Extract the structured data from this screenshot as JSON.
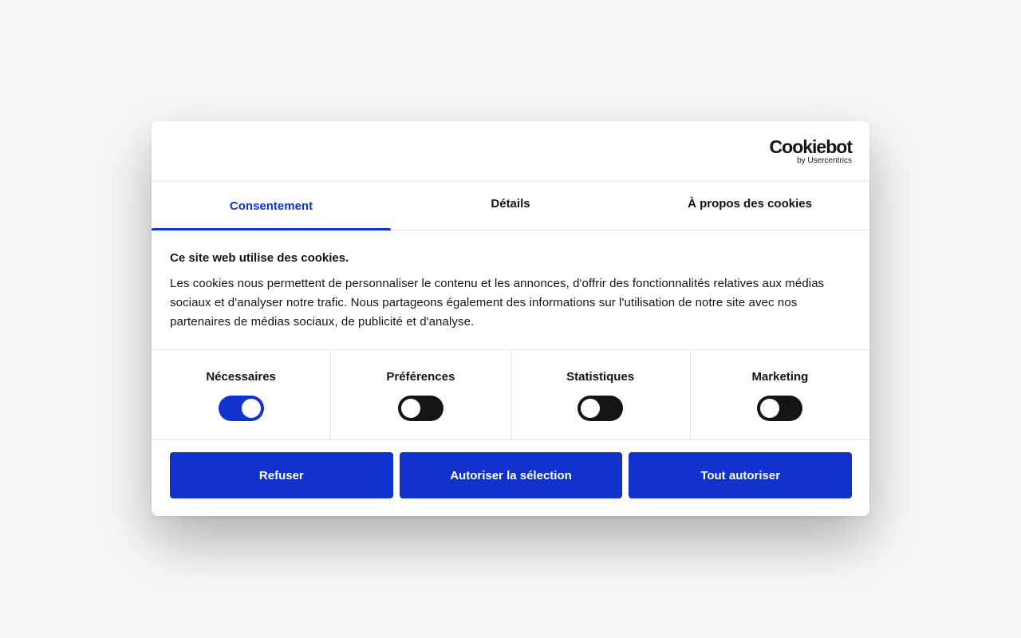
{
  "logo": {
    "main": "Cookiebot",
    "sub": "by Usercentrics"
  },
  "tabs": [
    {
      "label": "Consentement",
      "active": true
    },
    {
      "label": "Détails",
      "active": false
    },
    {
      "label": "À propos des cookies",
      "active": false
    }
  ],
  "content": {
    "title": "Ce site web utilise des cookies.",
    "body": "Les cookies nous permettent de personnaliser le contenu et les annonces, d'offrir des fonctionnalités relatives aux médias sociaux et d'analyser notre trafic. Nous partageons également des informations sur l'utilisation de notre site avec nos partenaires de médias sociaux, de publicité et d'analyse."
  },
  "toggles": [
    {
      "label": "Nécessaires",
      "checked": true
    },
    {
      "label": "Préférences",
      "checked": false
    },
    {
      "label": "Statistiques",
      "checked": false
    },
    {
      "label": "Marketing",
      "checked": false
    }
  ],
  "buttons": {
    "refuse": "Refuser",
    "allow_selection": "Autoriser la sélection",
    "allow_all": "Tout autoriser"
  },
  "colors": {
    "accent": "#1032cf",
    "text": "#141414",
    "toggle_off": "#141414",
    "background": "#f7f8fa"
  }
}
